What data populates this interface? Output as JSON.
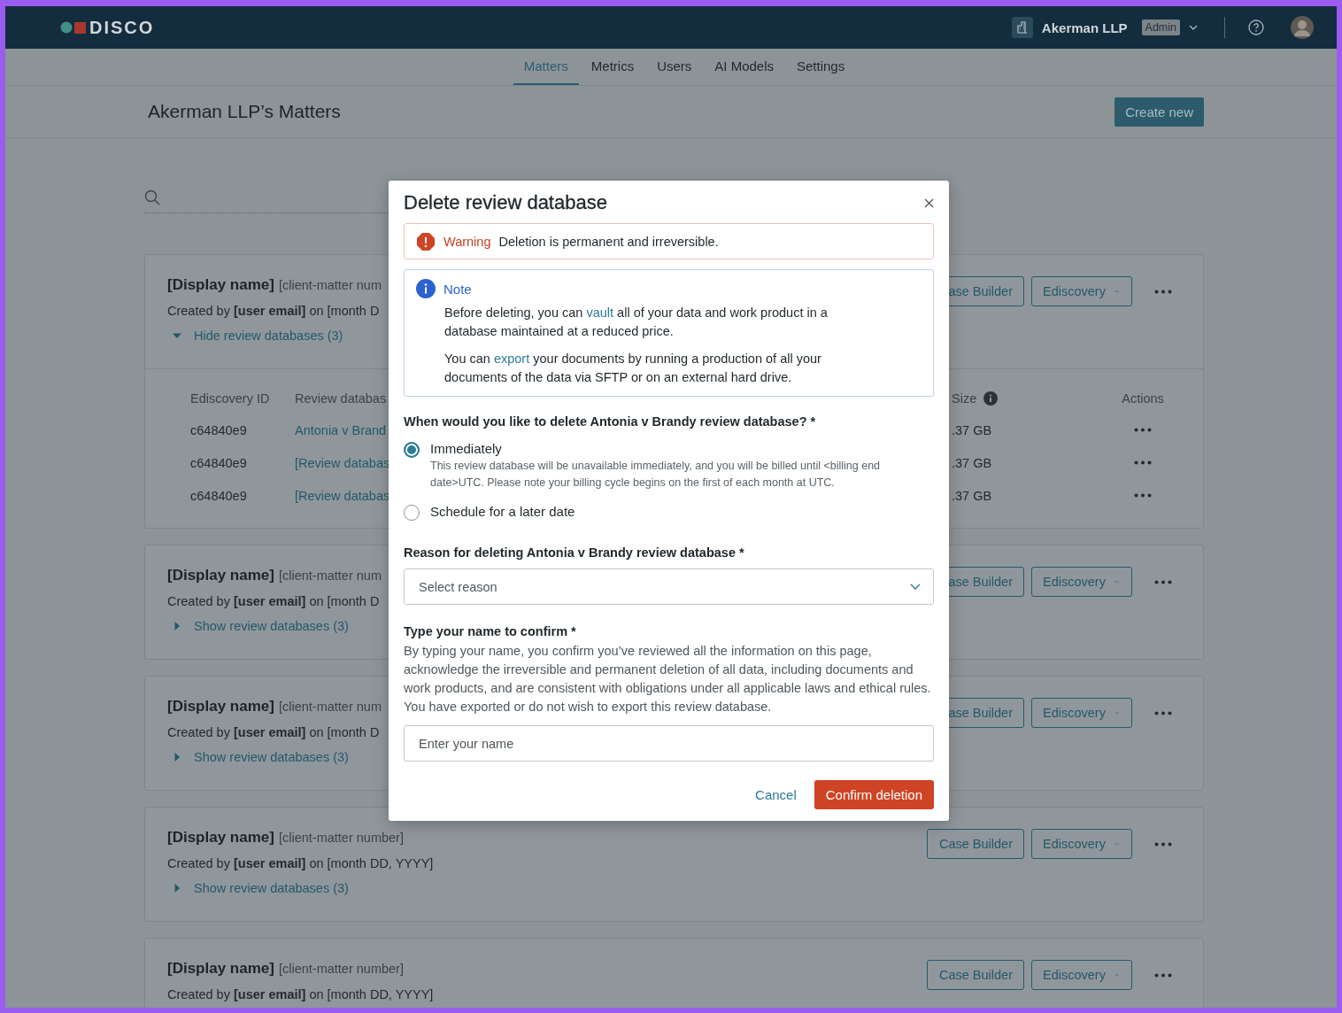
{
  "header": {
    "logo": "DISCO",
    "org": "Akerman LLP",
    "role_badge": "Admin"
  },
  "nav": [
    {
      "label": "Matters",
      "selected": true
    },
    {
      "label": "Metrics",
      "selected": false
    },
    {
      "label": "Users",
      "selected": false
    },
    {
      "label": "AI Models",
      "selected": false
    },
    {
      "label": "Settings",
      "selected": false
    }
  ],
  "page_title": "Akerman LLP’s Matters",
  "create_button": "Create new",
  "matters": [
    {
      "title": "[Display name]",
      "client_matter": "[client-matter num",
      "created": "Created by **[user email]** on [month D",
      "toggle": {
        "label": "Hide review databases (3)",
        "expanded": true
      },
      "case_builder": "ase Builder",
      "ediscovery": "Ediscovery",
      "table": {
        "columns": [
          "Ediscovery ID",
          "Review databas",
          "Size",
          "Actions"
        ],
        "rows": [
          {
            "id": "c64840e9",
            "name": "Antonia v Brand",
            "size": ".37 GB"
          },
          {
            "id": "c64840e9",
            "name": "[Review databas",
            "size": ".37 GB"
          },
          {
            "id": "c64840e9",
            "name": "[Review databas",
            "size": ".37 GB"
          }
        ]
      }
    },
    {
      "title": "[Display name]",
      "client_matter": "[client-matter num",
      "created": "Created by **[user email]** on [month D",
      "toggle": {
        "label": "Show review databases (3)",
        "expanded": false
      },
      "case_builder": "ase Builder",
      "ediscovery": "Ediscovery"
    },
    {
      "title": "[Display name]",
      "client_matter": "[client-matter num",
      "created": "Created by **[user email]** on [month D",
      "toggle": {
        "label": "Show review databases (3)",
        "expanded": false
      },
      "case_builder": "ase Builder",
      "ediscovery": "Ediscovery"
    },
    {
      "title": "[Display name]",
      "client_matter": "[client-matter number]",
      "created": "Created by **[user email]** on [month DD, YYYY]",
      "toggle": {
        "label": "Show review databases (3)",
        "expanded": false
      },
      "case_builder": "Case Builder",
      "ediscovery": "Ediscovery"
    },
    {
      "title": "[Display name]",
      "client_matter": "[client-matter number]",
      "created": "Created by **[user email]** on [month DD, YYYY]",
      "case_builder": "Case Builder",
      "ediscovery": "Ediscovery"
    }
  ],
  "modal": {
    "title": "Delete review database",
    "warning": {
      "label": "Warning",
      "text": "Deletion is permanent and irreversible."
    },
    "note": {
      "label": "Note",
      "paragraphs": [
        {
          "before": "Before deleting, you can",
          "link": "vault",
          "after": "all of your data and work product in a database maintained at a reduced price."
        },
        {
          "before": "You can",
          "link": "export",
          "after": "your documents by running a production of all your documents of the data via SFTP or on an external hard drive."
        }
      ]
    },
    "when_label": "When would you like to delete Antonia v Brandy review database? *",
    "options": [
      {
        "label": "Immediately",
        "description": "This review database will be unavailable immediately, and you will be billed until <billing end date>UTC. Please note your billing cycle begins on the first of each month at UTC.",
        "selected": true
      },
      {
        "label": "Schedule for a later date",
        "selected": false
      }
    ],
    "reason_label": "Reason for deleting Antonia v Brandy review database *",
    "reason_select": {
      "placeholder": "Select reason"
    },
    "confirm_label": "Type your name to confirm *",
    "confirm_text": "By typing your name, you confirm you’ve reviewed all the information on this page, acknowledge the irreversible and permanent deletion of all data, including documents and work products, and are consistent with obligations under all applicable laws and ethical rules. You have exported or do not wish to export this review database.",
    "name_field": {
      "placeholder": "Enter your name"
    },
    "cancel": "Cancel",
    "confirm": "Confirm deletion"
  }
}
